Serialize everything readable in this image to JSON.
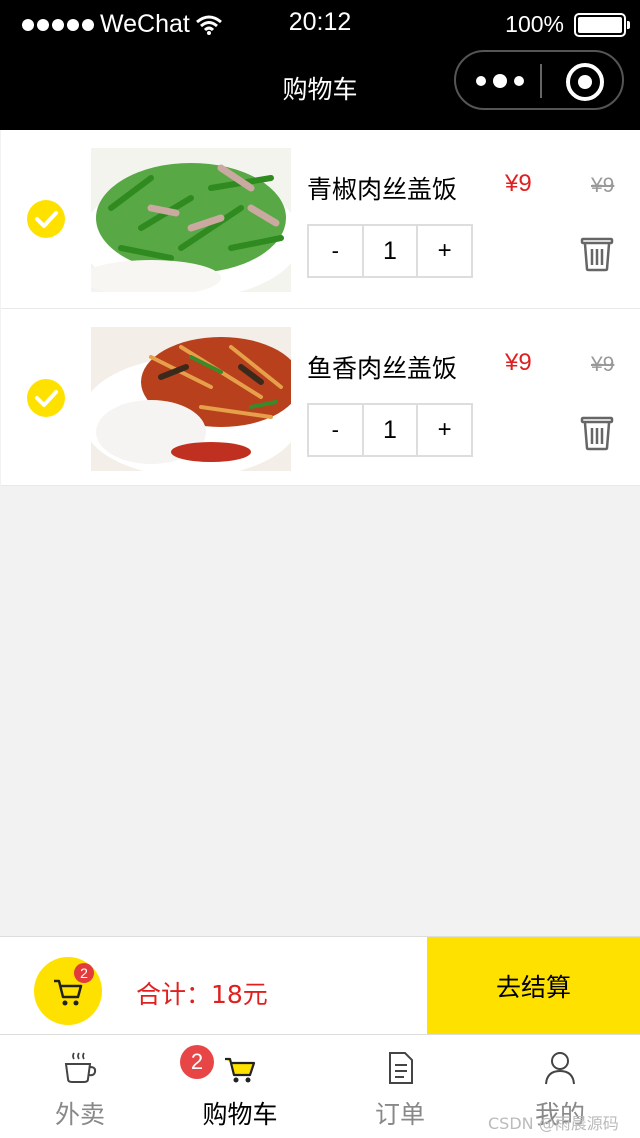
{
  "status_bar": {
    "carrier": "WeChat",
    "time": "20:12",
    "battery": "100%"
  },
  "nav": {
    "title": "购物车"
  },
  "cart": {
    "items": [
      {
        "name": "青椒肉丝盖饭",
        "price": "¥9",
        "old_price": "¥9",
        "quantity": "1",
        "minus": "-",
        "plus": "+",
        "checked": true
      },
      {
        "name": "鱼香肉丝盖饭",
        "price": "¥9",
        "old_price": "¥9",
        "quantity": "1",
        "minus": "-",
        "plus": "+",
        "checked": true
      }
    ]
  },
  "footer": {
    "cart_count": "2",
    "total": "合计：18元",
    "checkout_label": "去结算"
  },
  "tabbar": {
    "tabs": [
      {
        "label": "外卖",
        "icon": "coffee-cup-icon"
      },
      {
        "label": "购物车",
        "icon": "cart-icon",
        "badge": "2"
      },
      {
        "label": "订单",
        "icon": "document-icon"
      },
      {
        "label": "我的",
        "icon": "user-icon"
      }
    ]
  },
  "watermark": "CSDN @雨晨源码",
  "colors": {
    "accent": "#ffe100",
    "price": "#e02020",
    "badge": "#e84646"
  }
}
